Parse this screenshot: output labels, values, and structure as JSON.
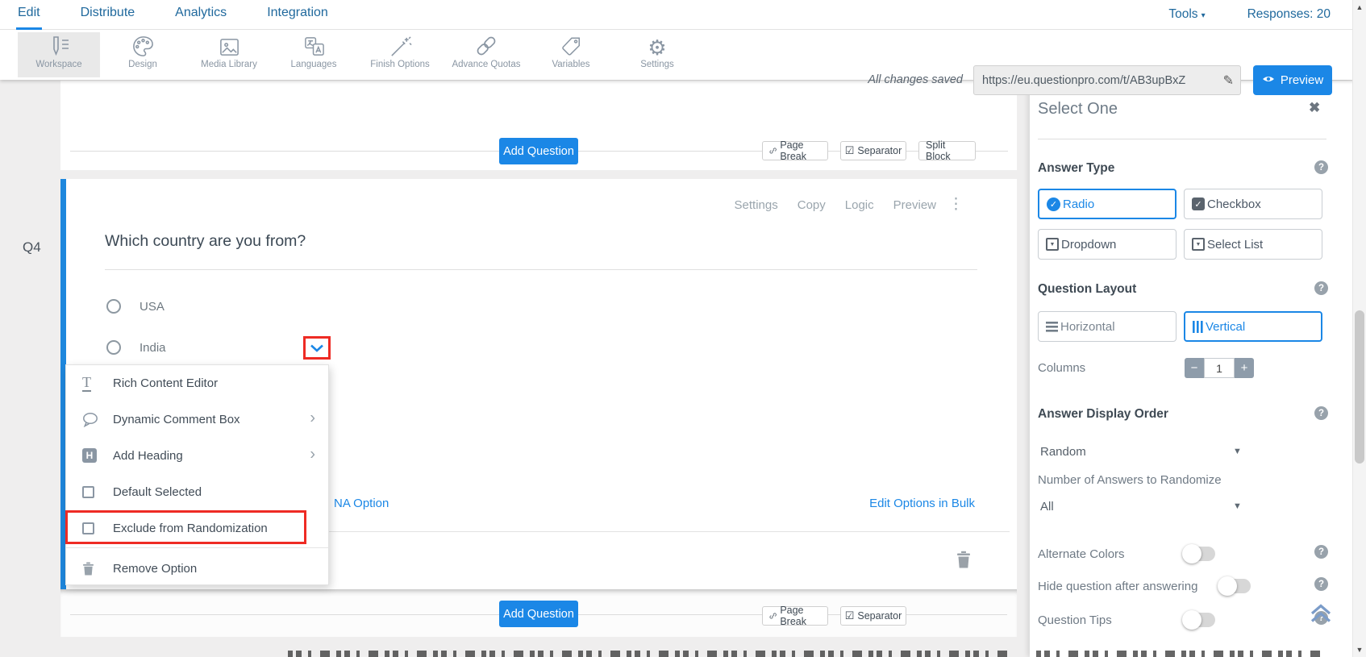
{
  "colors": {
    "accent": "#1b87e6",
    "nav_blue": "#20699d",
    "highlight_red": "#ee2b24"
  },
  "topnav": {
    "items": [
      {
        "label": "Edit"
      },
      {
        "label": "Distribute"
      },
      {
        "label": "Analytics"
      },
      {
        "label": "Integration"
      }
    ],
    "tools_label": "Tools",
    "responses_label": "Responses: 20"
  },
  "toolbar": {
    "items": [
      {
        "label": "Workspace"
      },
      {
        "label": "Design"
      },
      {
        "label": "Media Library"
      },
      {
        "label": "Languages"
      },
      {
        "label": "Finish Options"
      },
      {
        "label": "Advance Quotas"
      },
      {
        "label": "Variables"
      },
      {
        "label": "Settings"
      }
    ],
    "saved_status": "All changes saved",
    "url_value": "https://eu.questionpro.com/t/AB3upBxZ",
    "preview_label": "Preview"
  },
  "survey": {
    "add_question_label": "Add Question",
    "page_break_label": "Page Break",
    "separator_label": "Separator",
    "split_block_label": "Split Block",
    "question": {
      "id": "Q4",
      "title": "Which country are you from?",
      "actions": [
        {
          "label": "Settings"
        },
        {
          "label": "Copy"
        },
        {
          "label": "Logic"
        },
        {
          "label": "Preview"
        }
      ],
      "options": [
        {
          "label": "USA"
        },
        {
          "label": "India"
        }
      ],
      "na_option_label": "NA Option",
      "edit_bulk_label": "Edit Options in Bulk"
    },
    "option_menu": {
      "items": [
        {
          "label": "Rich Content Editor"
        },
        {
          "label": "Dynamic Comment Box"
        },
        {
          "label": "Add Heading"
        },
        {
          "label": "Default Selected"
        },
        {
          "label": "Exclude from Randomization"
        },
        {
          "label": "Remove Option"
        }
      ]
    }
  },
  "sidebar": {
    "title": "Select One",
    "answer_type": {
      "label": "Answer Type",
      "selected": "Radio",
      "options": [
        {
          "label": "Radio"
        },
        {
          "label": "Checkbox"
        },
        {
          "label": "Dropdown"
        },
        {
          "label": "Select List"
        }
      ]
    },
    "question_layout": {
      "label": "Question Layout",
      "selected": "Vertical",
      "options": [
        {
          "label": "Horizontal"
        },
        {
          "label": "Vertical"
        }
      ],
      "columns_label": "Columns",
      "columns_value": "1"
    },
    "answer_display_order": {
      "label": "Answer Display Order",
      "value": "Random",
      "randomize_count_label": "Number of Answers to Randomize",
      "randomize_count_value": "All"
    },
    "toggles": [
      {
        "label": "Alternate Colors",
        "on": false
      },
      {
        "label": "Hide question after answering",
        "on": false
      },
      {
        "label": "Question Tips",
        "on": false
      }
    ]
  }
}
